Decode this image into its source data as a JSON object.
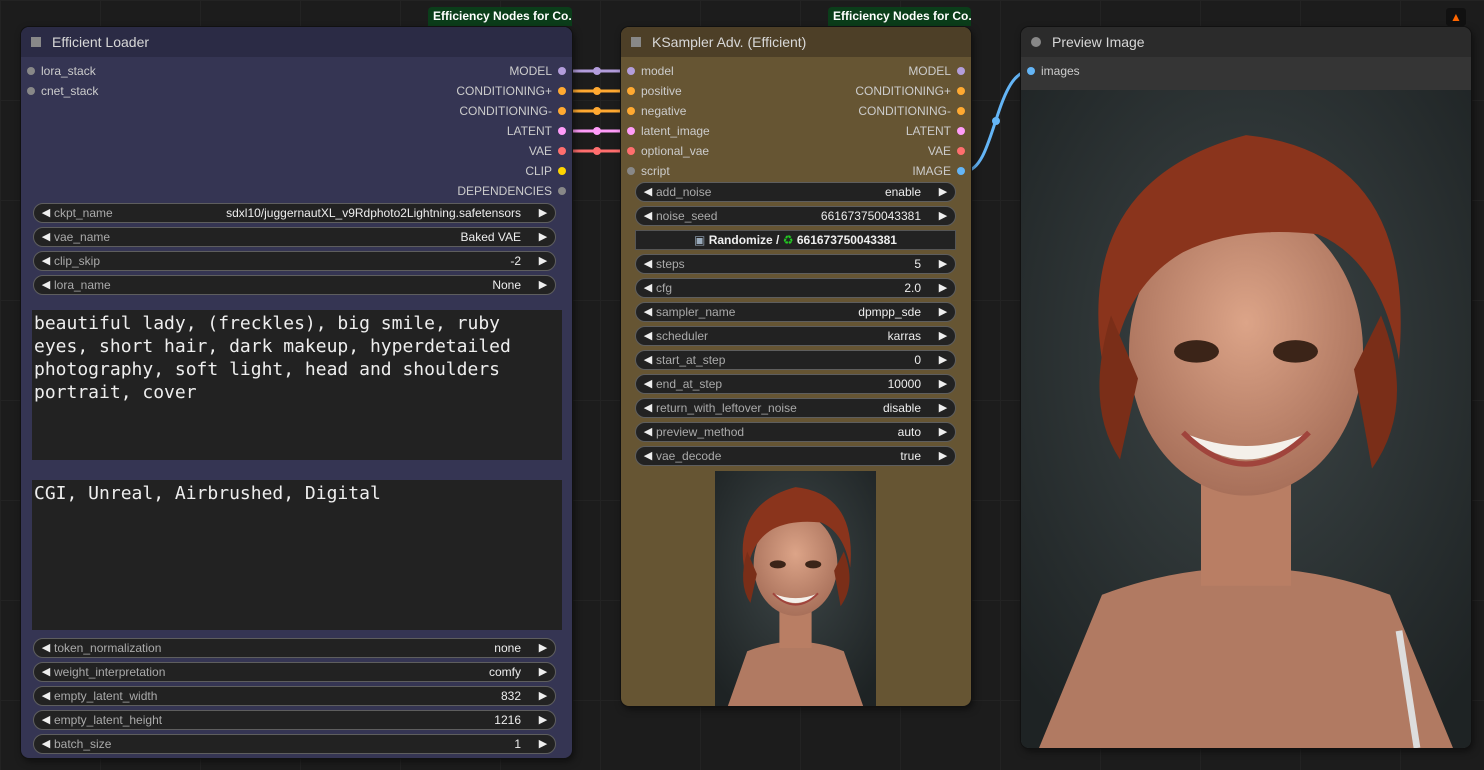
{
  "badges": {
    "loader": "Efficiency Nodes for Co..",
    "ksampler": "Efficiency Nodes for Co.."
  },
  "colors": {
    "model": "#b39ddb",
    "conditioning": "#ffa931",
    "latent": "#ff9cf9",
    "vae": "#ff6e6e",
    "clip": "#ffd500",
    "image": "#64b5f6",
    "inactive": "#888888",
    "loader_body": "#353553",
    "loader_title": "#2b2b45",
    "ksampler_body": "#665533",
    "ksampler_title": "#4d3f27",
    "preview_body": "#353535",
    "preview_title": "#2b2b2b"
  },
  "loader": {
    "title": "Efficient Loader",
    "inputs": [
      "lora_stack",
      "cnet_stack"
    ],
    "outputs": [
      "MODEL",
      "CONDITIONING+",
      "CONDITIONING-",
      "LATENT",
      "VAE",
      "CLIP",
      "DEPENDENCIES"
    ],
    "widgets_top": [
      {
        "name": "ckpt_name",
        "value": "sdxl10/juggernautXL_v9Rdphoto2Lightning.safetensors"
      },
      {
        "name": "vae_name",
        "value": "Baked VAE"
      },
      {
        "name": "clip_skip",
        "value": "-2"
      },
      {
        "name": "lora_name",
        "value": "None"
      }
    ],
    "positive_prompt": "beautiful lady, (freckles), big smile, ruby eyes, short hair, dark makeup, hyperdetailed photography, soft light, head and shoulders portrait, cover",
    "negative_prompt": "CGI, Unreal, Airbrushed, Digital",
    "widgets_bottom": [
      {
        "name": "token_normalization",
        "value": "none"
      },
      {
        "name": "weight_interpretation",
        "value": "comfy"
      },
      {
        "name": "empty_latent_width",
        "value": "832"
      },
      {
        "name": "empty_latent_height",
        "value": "1216"
      },
      {
        "name": "batch_size",
        "value": "1"
      }
    ]
  },
  "ksampler": {
    "title": "KSampler Adv. (Efficient)",
    "inputs": [
      "model",
      "positive",
      "negative",
      "latent_image",
      "optional_vae",
      "script"
    ],
    "outputs": [
      "MODEL",
      "CONDITIONING+",
      "CONDITIONING-",
      "LATENT",
      "VAE",
      "IMAGE"
    ],
    "widgets_a": [
      {
        "name": "add_noise",
        "value": "enable"
      },
      {
        "name": "noise_seed",
        "value": "661673750043381"
      }
    ],
    "randomize": {
      "label": "Randomize /",
      "value": "661673750043381"
    },
    "widgets_b": [
      {
        "name": "steps",
        "value": "5"
      },
      {
        "name": "cfg",
        "value": "2.0"
      },
      {
        "name": "sampler_name",
        "value": "dpmpp_sde"
      },
      {
        "name": "scheduler",
        "value": "karras"
      },
      {
        "name": "start_at_step",
        "value": "0"
      },
      {
        "name": "end_at_step",
        "value": "10000"
      },
      {
        "name": "return_with_leftover_noise",
        "value": "disable"
      },
      {
        "name": "preview_method",
        "value": "auto"
      },
      {
        "name": "vae_decode",
        "value": "true"
      }
    ]
  },
  "preview": {
    "title": "Preview Image",
    "inputs": [
      "images"
    ]
  },
  "icons": {
    "left_arrow": "◀",
    "right_arrow": "▶",
    "cube": "cube-icon",
    "recycle": "recycle-icon",
    "corner": "comfy-logo-icon"
  }
}
